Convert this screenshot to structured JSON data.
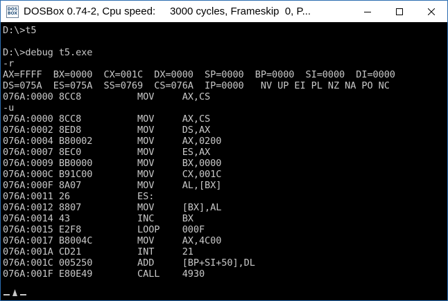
{
  "window": {
    "title": "DOSBox 0.74-2, Cpu speed:     3000 cycles, Frameskip  0, P...",
    "icon_text_top": "DOS",
    "icon_text_bottom": "BOX"
  },
  "controls": {
    "minimize": "minimize-icon",
    "maximize": "maximize-icon",
    "close": "close-icon"
  },
  "console_text": "D:\\>t5\n\nD:\\>debug t5.exe\n-r\nAX=FFFF  BX=0000  CX=001C  DX=0000  SP=0000  BP=0000  SI=0000  DI=0000\nDS=075A  ES=075A  SS=0769  CS=076A  IP=0000   NV UP EI PL NZ NA PO NC\n076A:0000 8CC8          MOV     AX,CS\n-u\n076A:0000 8CC8          MOV     AX,CS\n076A:0002 8ED8          MOV     DS,AX\n076A:0004 B80002        MOV     AX,0200\n076A:0007 8EC0          MOV     ES,AX\n076A:0009 BB0000        MOV     BX,0000\n076A:000C B91C00        MOV     CX,001C\n076A:000F 8A07          MOV     AL,[BX]\n076A:0011 26            ES:\n076A:0012 8807          MOV     [BX],AL\n076A:0014 43            INC     BX\n076A:0015 E2F8          LOOP    000F\n076A:0017 B8004C        MOV     AX,4C00\n076A:001A CD21          INT     21\n076A:001C 005250        ADD     [BP+SI+50],DL\n076A:001F E80E49        CALL    4930",
  "colors": {
    "console_bg": "#000000",
    "console_fg": "#c8c8c8",
    "titlebar_bg": "#ffffff",
    "border": "#2b6cb0"
  }
}
